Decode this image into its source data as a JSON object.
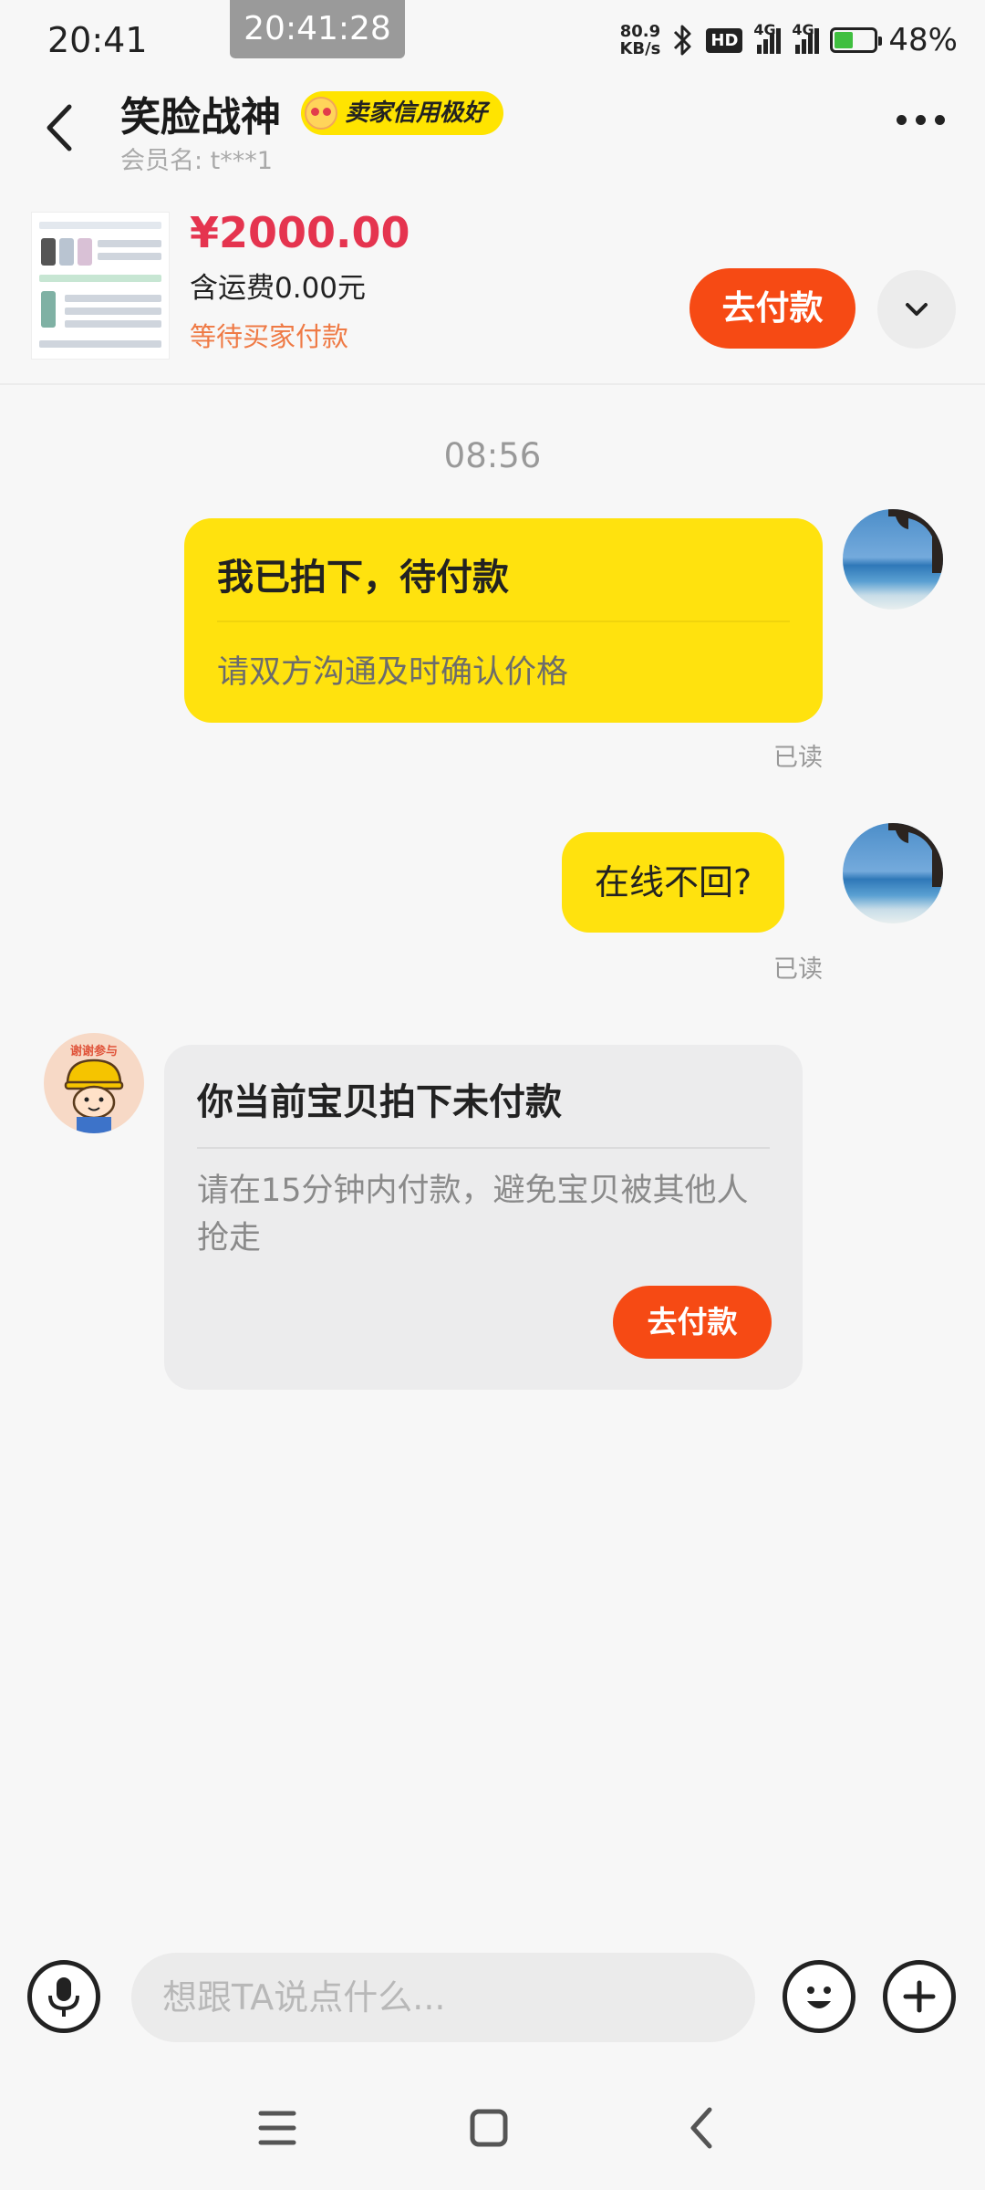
{
  "status_bar": {
    "time": "20:41",
    "overlay_time": "20:41:28",
    "net_speed_value": "80.9",
    "net_speed_unit": "KB/s",
    "hd_label": "HD",
    "network_1": "4G",
    "network_2": "4G",
    "battery": "48%",
    "battery_level": 0.48
  },
  "header": {
    "seller_name": "笑脸战神",
    "credit_badge": "卖家信用极好",
    "member_label": "会员名: t***1"
  },
  "order": {
    "price": "¥2000.00",
    "shipping": "含运费0.00元",
    "status": "等待买家付款",
    "pay_button": "去付款"
  },
  "chat": {
    "timestamp": "08:56",
    "messages": [
      {
        "title": "我已拍下，待付款",
        "subtitle": "请双方沟通及时确认价格",
        "read": "已读"
      },
      {
        "text": "在线不回?",
        "read": "已读"
      },
      {
        "title": "你当前宝贝拍下未付款",
        "subtitle": "请在15分钟内付款，避免宝贝被其他人抢走",
        "button": "去付款"
      }
    ],
    "bot_avatar_text": "谢谢参与"
  },
  "input_bar": {
    "placeholder": "想跟TA说点什么..."
  },
  "colors": {
    "accent_orange": "#f64a14",
    "bubble_yellow": "#ffe20e",
    "price_red": "#e5344f"
  },
  "icons": [
    "back-icon",
    "bluetooth-icon",
    "more-icon",
    "chevron-down-icon",
    "microphone-icon",
    "emoji-icon",
    "plus-icon",
    "menu-nav-icon",
    "home-nav-icon",
    "back-nav-icon"
  ]
}
